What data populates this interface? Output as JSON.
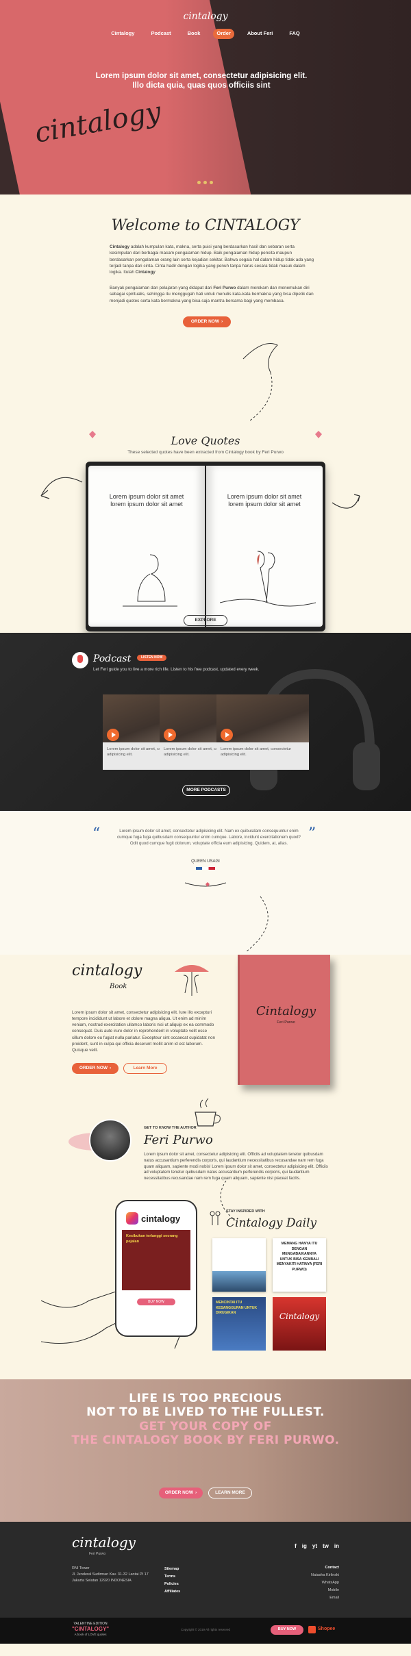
{
  "nav": {
    "logo": "cintalogy",
    "items": [
      "Cintalogy",
      "Podcast",
      "Book",
      "Order",
      "About Feri",
      "FAQ"
    ],
    "active": "Order"
  },
  "hero": {
    "headline": "Lorem ipsum dolor sit amet, consectetur adipisicing elit. Illo dicta quia, quas quos officiis sint",
    "script_logo": "cintalogy"
  },
  "welcome": {
    "title": "Welcome to CINTALOGY",
    "para1_bold": "Cintalogy",
    "para1": " adalah kumpulan kata, makna, serta puisi yang berdasarkan hasil dan sebaran serta kesimpulan dari berbagai macam pengalaman hidup. Baik pengalaman hidup pencita maupun berdasarkan pengalaman orang lain serta kejadian sekitar. Bahwa segala hal dalam hidup tidak ada yang terjadi tanpa dari cinta. Cinta hadir dengan logika yang penuh tanpa harus secara tidak masuk dalam logika. Itulah ",
    "para1_end": "Cintalogy",
    "para2_a": "Banyak pengalaman dan pelajaran yang didapat dari ",
    "para2_bold": "Feri Purwo",
    "para2_b": " dalam merekam dan menemukan diri sebagai spiritualis, sehingga itu menggugah hati untuk menulis kata-kata bermakna yang bisa dipetik dan menjadi quotes serta kata bermakna yang bisa saja mantra bersama bagi yang membaca.",
    "order_btn": "ORDER NOW"
  },
  "love_quotes": {
    "title": "Love Quotes",
    "subtitle": "These selected quotes have been extracted from Cintalogy book by Feri Purwo",
    "left_page": "Lorem ipsum dolor sit amet lorem ipsum dolor sit amet",
    "right_page": "Lorem ipsum dolor sit amet lorem ipsum dolor sit amet",
    "explore_btn": "EXPLORE"
  },
  "podcast": {
    "title": "Podcast",
    "badge": "LISTEN NOW",
    "subtitle": "Let Feri guide you to live a more rich life. Listen to his free podcast, updated every week.",
    "cards": [
      {
        "text": "Lorem ipsum dolor sit amet, consectetur adipisicing elit."
      },
      {
        "text": "Lorem ipsum dolor sit amet, consectetur adipisicing elit."
      },
      {
        "text": "Lorem ipsum dolor sit amet, consectetur adipisicing elit."
      }
    ],
    "more_btn": "MORE PODCASTS"
  },
  "quote": {
    "text": "Lorem ipsum dolor sit amet, consectetur adipisicing elit. Nam ex quibusdam consequuntur enim cumque fuga fuga quibusdam consequuntur enim cumque. Labore, incidunt exercitationem quod? Odit quod cumque fugit dolorum, voluptate officia eum adipisicing. Quidem, at, alias.",
    "author": "QUEEN USAGI"
  },
  "book": {
    "logo": "cintalogy",
    "sub": "Book",
    "cover_title": "Cintalogy",
    "cover_author": "Feri Purwo",
    "desc": "Lorem ipsum dolor sit amet, consectetur adipisicing elit. Iure illo excepturi tempore incididunt ut labore et dolore magna aliqua. Ut enim ad minim veniam, nostrud exercitation ullamco laboris nisi ut aliquip ex ea commodo consequat. Duis aute irure dolor in reprehenderit in voluptate velit esse cillum dolore eu fugiat nulla pariatur. Excepteur sint occaecat cupidatat non proident, sunt in culpa qui officia deserunt mollit anim id est laborum. Quisque velit.",
    "order_btn": "ORDER NOW",
    "learn_btn": "Learn More"
  },
  "author": {
    "kicker": "GET TO KNOW THE AUTHOR",
    "name": "Feri Purwo",
    "bio": "Lorem ipsum dolor sit amet, consectetur adipisicing elit. Officiis ad voluptatem tenetur quibusdam natus accusantium perferendis corporis, qui laudantium necessitatibus recusandae nam rem fuga quam aliquam, sapiente modi nobis! Lorem ipsum dolor sit amet, consectetur adipisicing elit. Officiis ad voluptatem tenetur quibusdam natus accusantium perferendis corporis, qui laudantium necessitatibus recusandae nam rem fuga quam aliquam, sapiente nisi placeat facilis."
  },
  "daily": {
    "kicker": "STAY INSPIRED WITH",
    "title": "Cintalogy Daily",
    "phone_app": "cintalogy",
    "phone_btn": "BUY NOW",
    "phone_post": "Kesibukan terlanggi seorang pejalan",
    "tile2": "MEMANG HANYA ITU DENGAN MENGABAIKANNYA UNTUK BISA KEMBALI MENYAKITI HATINYA (FERI PURWO)",
    "tile3": "MENCINTAI ITU KESANGGUPAN UNTUK DIRUGIKAN",
    "tile4": "Cintalogy"
  },
  "slogan": {
    "line1": "LIFE IS TOO PRECIOUS",
    "line2": "NOT TO BE LIVED TO THE FULLEST.",
    "line3": "GET YOUR COPY OF",
    "line4": "THE CINTALOGY BOOK BY FERI PURWO.",
    "order_btn": "ORDER NOW",
    "learn_btn": "LEARN MORE"
  },
  "footer": {
    "logo": "cintalogy",
    "logo_sub": "Feri Purwo",
    "address": [
      "RNI Tower",
      "Jl. Jenderal Sudirman Kav. 31-32 Lantai PI 17",
      "Jakarta Selatan 12920 INDONESIA"
    ],
    "links": [
      "Sitemap",
      "Terms",
      "Policies",
      "Affiliates"
    ],
    "contact_title": "Contact",
    "contacts": [
      "Natasha Kirlinski",
      "WhatsApp",
      "Mobile",
      "Email"
    ],
    "social": [
      "f",
      "ig",
      "yt",
      "tw",
      "in"
    ]
  },
  "bottom": {
    "edition": "VALENTINE EDITION",
    "title": "\"CINTALOGY\"",
    "sub": "A book of LOVE quotes",
    "copyright": "Copyright © 2019 All rights reserved",
    "buy_btn": "BUY NOW",
    "shopee": "Shopee"
  }
}
